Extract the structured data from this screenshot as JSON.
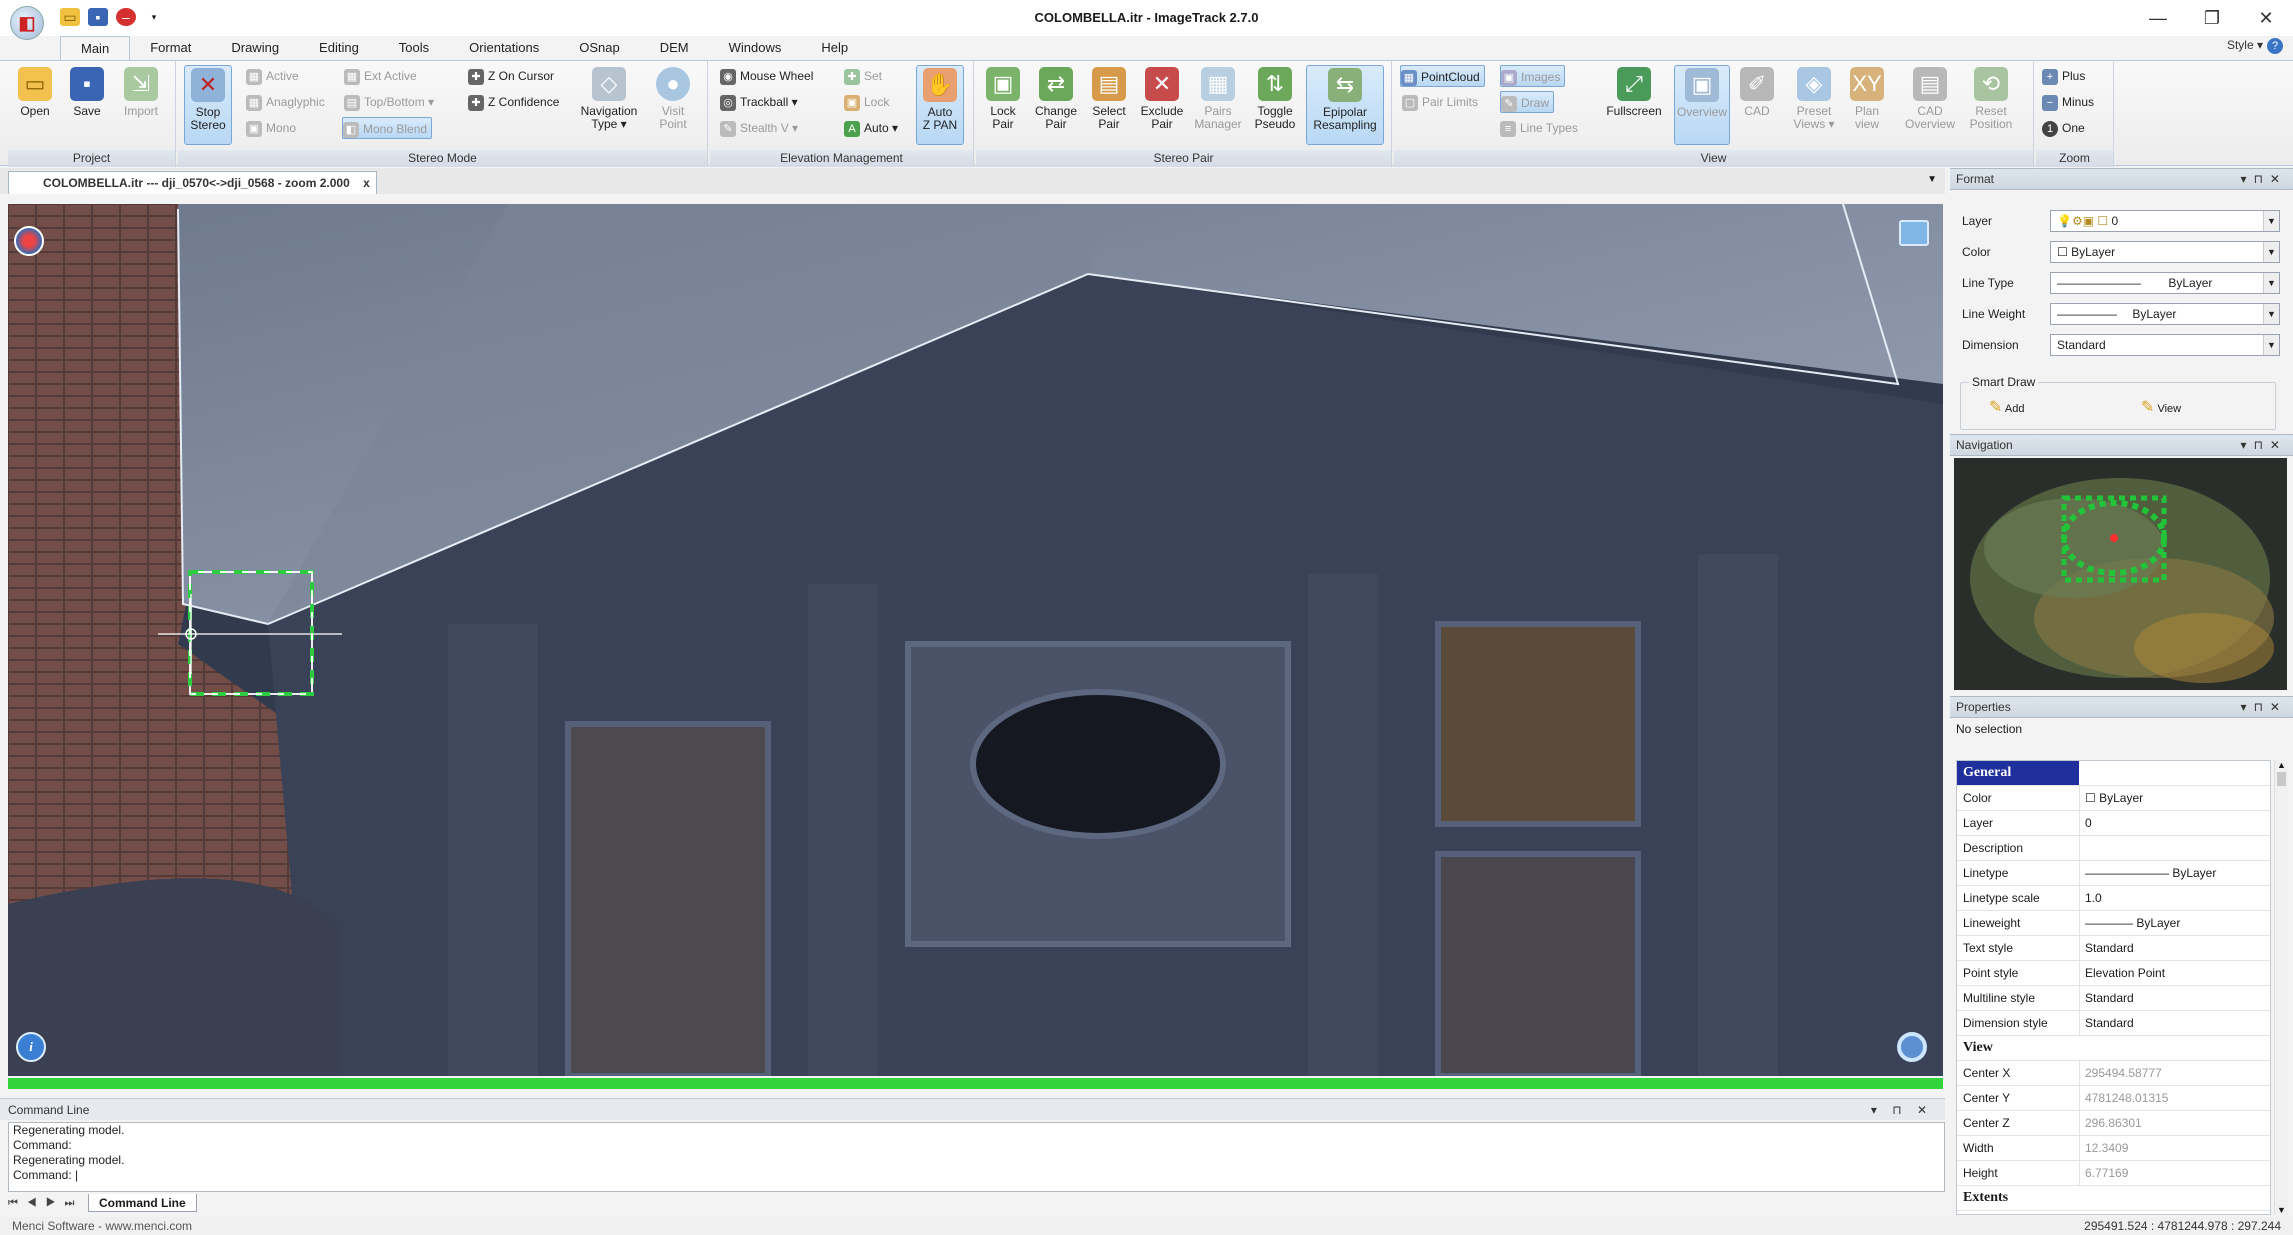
{
  "window": {
    "title": "COLOMBELLA.itr - ImageTrack 2.7.0",
    "controls": [
      "—",
      "❐",
      "✕"
    ]
  },
  "menu": {
    "tabs": [
      "Main",
      "Format",
      "Drawing",
      "Editing",
      "Tools",
      "Orientations",
      "OSnap",
      "DEM",
      "Windows",
      "Help"
    ],
    "style": "Style ▾"
  },
  "ribbon": {
    "project": {
      "label": "Project",
      "open": "Open",
      "save": "Save",
      "import": "Import"
    },
    "stereo_mode": {
      "label": "Stereo Mode",
      "stop": "Stop\nStereo",
      "active": "Active",
      "anaglyphic": "Anaglyphic",
      "mono": "Mono",
      "ext_active": "Ext Active",
      "top_bottom": "Top/Bottom ▾",
      "mono_blend": "Mono Blend",
      "z_on_cursor": "Z On Cursor",
      "z_confidence": "Z Confidence",
      "navigation_type": "Navigation\nType ▾",
      "visit_point": "Visit\nPoint"
    },
    "elevation": {
      "label": "Elevation Management",
      "mouse_wheel": "Mouse Wheel",
      "trackball": "Trackball ▾",
      "stealth": "Stealth V ▾",
      "set": "Set",
      "lock": "Lock",
      "auto": "Auto ▾",
      "auto_zpan": "Auto\nZ PAN"
    },
    "stereo_pair": {
      "label": "Stereo Pair",
      "lock_pair": "Lock\nPair",
      "change_pair": "Change\nPair",
      "select_pair": "Select\nPair",
      "exclude_pair": "Exclude\nPair",
      "pairs_manager": "Pairs\nManager",
      "toggle_pseudo": "Toggle\nPseudo",
      "epipolar": "Epipolar\nResampling"
    },
    "view": {
      "label": "View",
      "pointcloud": "PointCloud",
      "images": "Images",
      "pair_limits": "Pair Limits",
      "draw": "Draw",
      "line_types": "Line Types",
      "fullscreen": "Fullscreen",
      "overview": "Overview",
      "cad": "CAD",
      "preset_views": "Preset\nViews ▾",
      "plan_view": "Plan\nview",
      "cad_overview": "CAD\nOverview",
      "reset_position": "Reset\nPosition"
    },
    "zoom": {
      "label": "Zoom",
      "plus": "Plus",
      "minus": "Minus",
      "one": "One"
    }
  },
  "document_tab": {
    "label": "COLOMBELLA.itr --- dji_0570<->dji_0568 - zoom 2.000",
    "close": "x"
  },
  "command_line": {
    "title": "Command Line",
    "lines": [
      "Regenerating model.",
      "Command:",
      "Regenerating model.",
      "Command:  |"
    ],
    "tab": "Command Line"
  },
  "status": {
    "left": "Menci Software - www.menci.com",
    "coords": "295491.524 : 4781244.978 : 297.244"
  },
  "format_panel": {
    "title": "Format",
    "layer_label": "Layer",
    "layer_value": "0",
    "color_label": "Color",
    "color_value": "ByLayer",
    "linetype_label": "Line Type",
    "linetype_value": "ByLayer",
    "lineweight_label": "Line Weight",
    "lineweight_value": "ByLayer",
    "dimension_label": "Dimension",
    "dimension_value": "Standard",
    "smart_draw": "Smart Draw",
    "add": "Add",
    "view": "View"
  },
  "navigation_panel": {
    "title": "Navigation"
  },
  "properties_panel": {
    "title": "Properties",
    "selection": "No selection",
    "rows": [
      {
        "k": "General",
        "v": "",
        "cat": true
      },
      {
        "k": "Color",
        "v": "☐ ByLayer"
      },
      {
        "k": "Layer",
        "v": "0"
      },
      {
        "k": "Description",
        "v": ""
      },
      {
        "k": "Linetype",
        "v": "———————  ByLayer"
      },
      {
        "k": "Linetype scale",
        "v": "1.0"
      },
      {
        "k": "Lineweight",
        "v": "————  ByLayer"
      },
      {
        "k": "Text style",
        "v": "Standard"
      },
      {
        "k": "Point style",
        "v": "Elevation Point"
      },
      {
        "k": "Multiline style",
        "v": "Standard"
      },
      {
        "k": "Dimension style",
        "v": "Standard"
      },
      {
        "k": "View",
        "v": "",
        "cat": true
      },
      {
        "k": "Center X",
        "v": "295494.58777",
        "muted": true
      },
      {
        "k": "Center Y",
        "v": "4781248.01315",
        "muted": true
      },
      {
        "k": "Center Z",
        "v": "296.86301",
        "muted": true
      },
      {
        "k": "Width",
        "v": "12.3409",
        "muted": true
      },
      {
        "k": "Height",
        "v": "6.77169",
        "muted": true
      },
      {
        "k": "Extents",
        "v": "",
        "cat": true
      }
    ]
  }
}
